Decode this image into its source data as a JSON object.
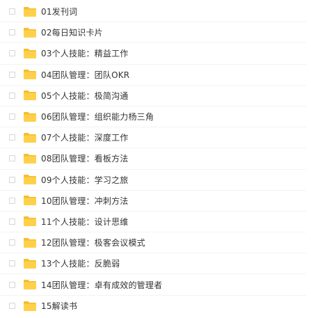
{
  "colors": {
    "folder_body": "#FFD04B",
    "folder_tab": "#F5BE2E",
    "text": "#333333"
  },
  "items": [
    {
      "name": "01发刊词",
      "icon": "folder-icon"
    },
    {
      "name": "02每日知识卡片",
      "icon": "folder-icon"
    },
    {
      "name": "03个人技能：精益工作",
      "icon": "folder-icon"
    },
    {
      "name": "04团队管理：团队OKR",
      "icon": "folder-icon"
    },
    {
      "name": "05个人技能：极简沟通",
      "icon": "folder-icon"
    },
    {
      "name": "06团队管理：组织能力杨三角",
      "icon": "folder-icon"
    },
    {
      "name": "07个人技能：深度工作",
      "icon": "folder-icon"
    },
    {
      "name": "08团队管理：看板方法",
      "icon": "folder-icon"
    },
    {
      "name": "09个人技能：学习之旅",
      "icon": "folder-icon"
    },
    {
      "name": "10团队管理：冲刺方法",
      "icon": "folder-icon"
    },
    {
      "name": "11个人技能：设计思维",
      "icon": "folder-icon"
    },
    {
      "name": "12团队管理：极客会议模式",
      "icon": "folder-icon"
    },
    {
      "name": "13个人技能：反脆弱",
      "icon": "folder-icon"
    },
    {
      "name": "14团队管理：卓有成效的管理者",
      "icon": "folder-icon"
    },
    {
      "name": "15解读书",
      "icon": "folder-icon"
    }
  ]
}
